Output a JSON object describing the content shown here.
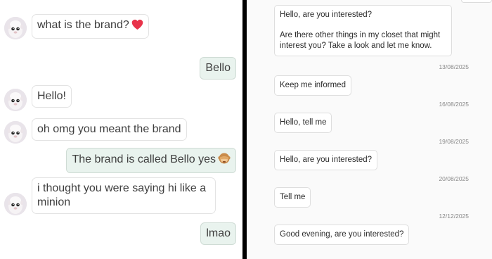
{
  "left_chat": {
    "messages": [
      {
        "side": "in",
        "text": "what is the brand?",
        "emoji": "heart"
      },
      {
        "side": "out",
        "text": "Bello"
      },
      {
        "side": "in",
        "text": "Hello!"
      },
      {
        "side": "in",
        "text": "oh omg you meant the brand"
      },
      {
        "side": "out",
        "text": "The brand is called Bello yes",
        "emoji": "see-no-evil-monkey"
      },
      {
        "side": "in",
        "text": "i thought you were saying hi like a minion"
      },
      {
        "side": "out",
        "text": "lmao"
      }
    ]
  },
  "right_chat": {
    "first_message": {
      "line1": "Hello, are you interested?",
      "line2": "Are there other things in my closet that might interest you? Take a look and let me know."
    },
    "entries": [
      {
        "date": "13/08/2025",
        "text": "Keep me informed"
      },
      {
        "date": "16/08/2025",
        "text": "Hello, tell me"
      },
      {
        "date": "19/08/2025",
        "text": "Hello, are you interested?"
      },
      {
        "date": "20/08/2025",
        "text": "Tell me"
      },
      {
        "date": "12/12/2025",
        "text": "Good evening, are you interested?"
      }
    ]
  },
  "colors": {
    "outgoing_bubble": "#e9f3ee",
    "incoming_bubble": "#ffffff",
    "divider": "#000000",
    "heart": "#e8334a",
    "monkey": "#c98b4a"
  }
}
